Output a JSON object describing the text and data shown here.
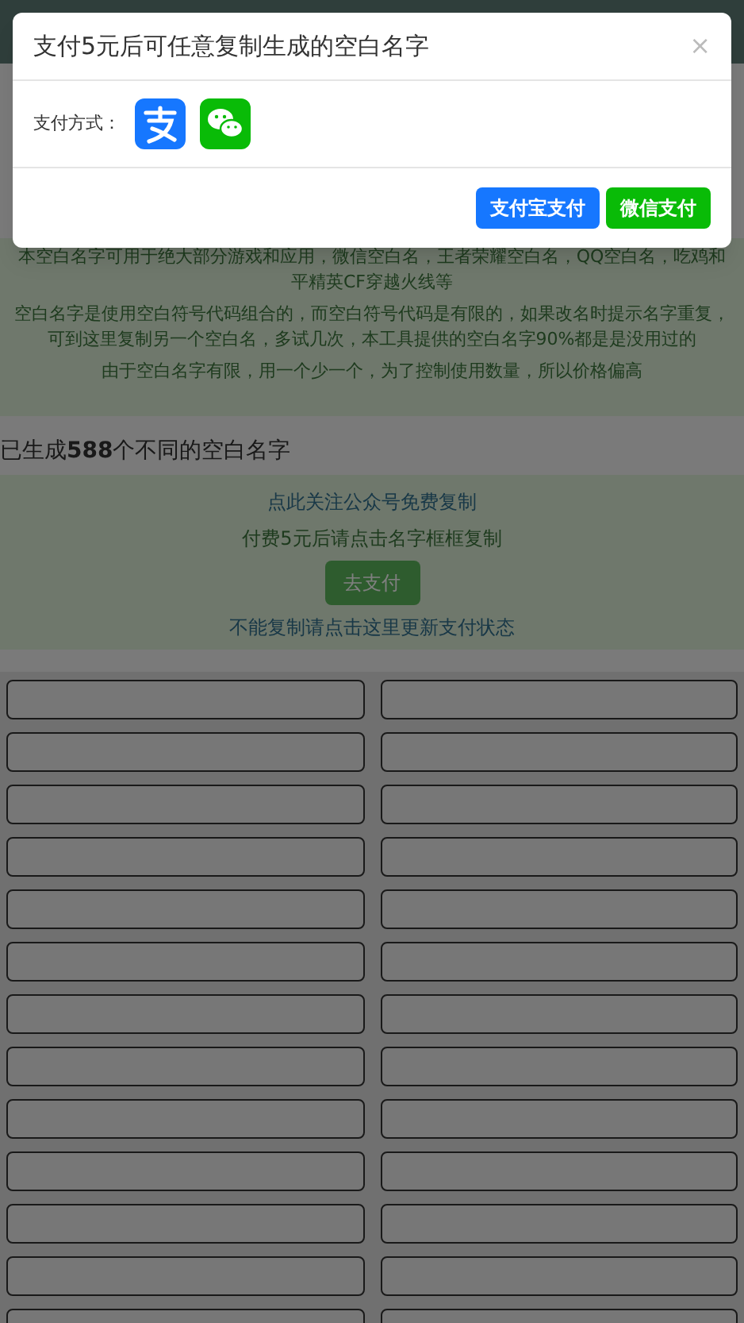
{
  "notes": [
    "本空白名字可用于绝大部分游戏和应用，微信空白名，王者荣耀空白名，QQ空白名，吃鸡和平精英CF穿越火线等",
    "空白名字是使用空白符号代码组合的，而空白符号代码是有限的，如果改名时提示名字重复，可到这里复制另一个空白名，多试几次，本工具提供的空白名字90%都是是没用过的",
    "由于空白名字有限，用一个少一个，为了控制使用数量，所以价格偏高"
  ],
  "generated_heading": "已生成**588**个不同的空白名字",
  "pay_box": {
    "follow_link": "点此关注公众号免费复制",
    "instruction": "付费5元后请点击名字框框复制",
    "pay_button": "去支付",
    "refresh_link": "不能复制请点击这里更新支付状态"
  },
  "name_fields": [
    {
      "kind": "blank"
    },
    {
      "kind": "blank"
    },
    {
      "kind": "blank"
    },
    {
      "kind": "blank"
    },
    {
      "kind": "blank"
    },
    {
      "kind": "blank"
    },
    {
      "kind": "blank"
    },
    {
      "kind": "blank"
    },
    {
      "kind": "blank"
    },
    {
      "kind": "blank"
    },
    {
      "kind": "blank"
    },
    {
      "kind": "blank"
    },
    {
      "kind": "blank"
    },
    {
      "kind": "blank"
    },
    {
      "kind": "blank"
    },
    {
      "kind": "blank"
    },
    {
      "kind": "blank"
    },
    {
      "kind": "blank"
    },
    {
      "kind": "blank"
    },
    {
      "kind": "blank"
    },
    {
      "kind": "blank"
    },
    {
      "kind": "blank"
    },
    {
      "kind": "blank"
    },
    {
      "kind": "blank"
    },
    {
      "kind": "blank"
    },
    {
      "kind": "blank"
    }
  ],
  "modal": {
    "title": "支付5元后可任意复制生成的空白名字",
    "close": "×",
    "method_label": "支付方式：",
    "methods": [
      {
        "kind": "alipay"
      },
      {
        "kind": "wechat"
      }
    ],
    "buttons": [
      {
        "label": "支付宝支付",
        "kind": "alipay"
      },
      {
        "label": "微信支付",
        "kind": "wechat"
      }
    ]
  }
}
